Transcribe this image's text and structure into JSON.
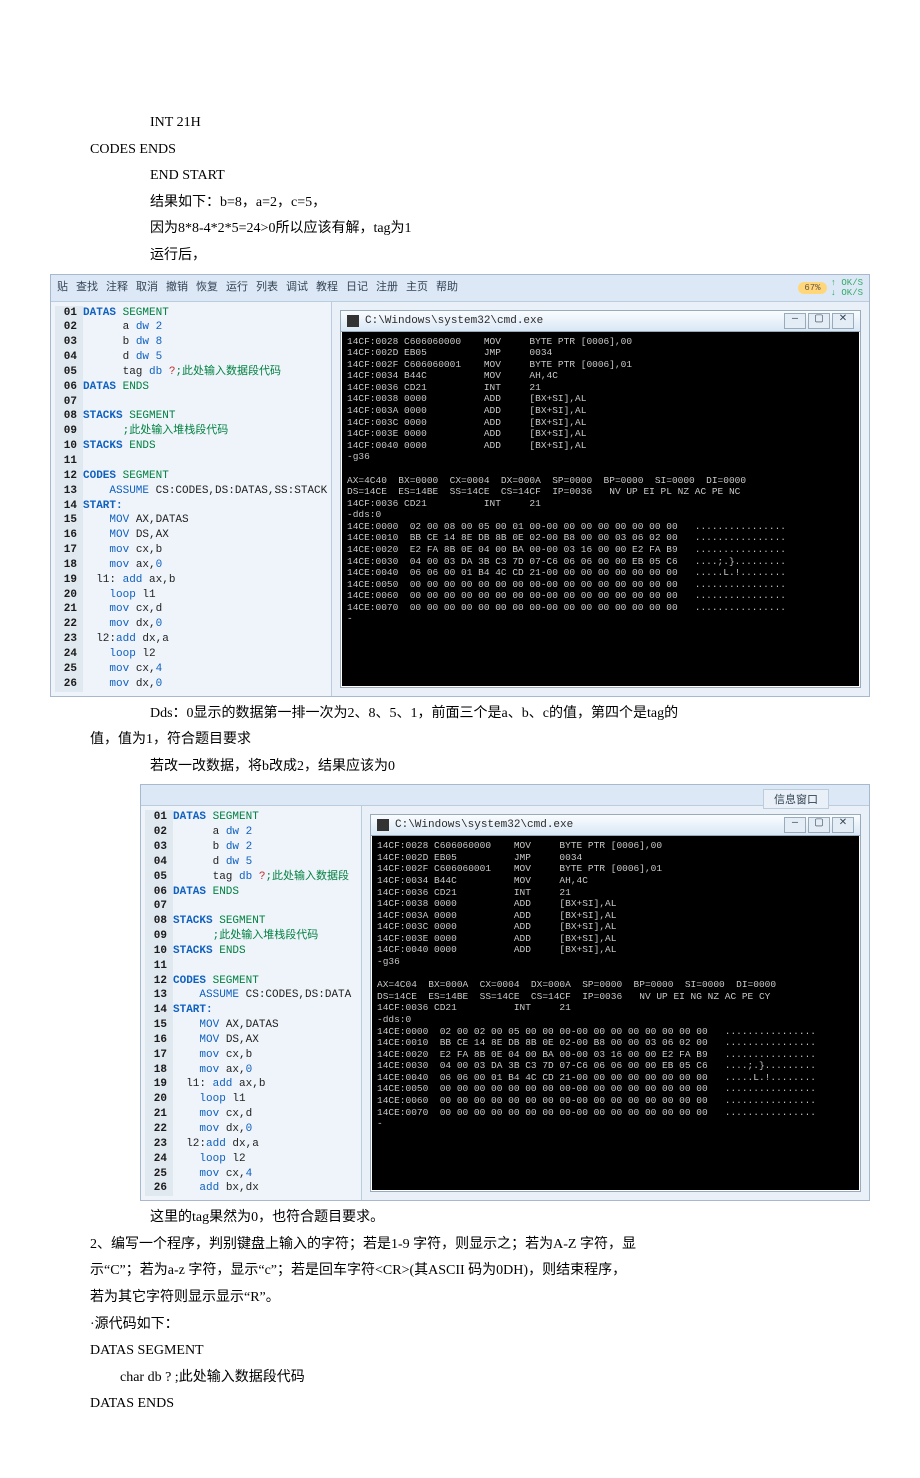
{
  "pre_lines": {
    "l1": "INT 21H",
    "l2": "CODES ENDS",
    "l3": "END START",
    "l4": "结果如下：b=8，a=2，c=5，",
    "l5": "因为8*8-4*2*5=24>0所以应该有解，tag为1",
    "l6": "运行后，"
  },
  "toolbar1": {
    "items": [
      "贴",
      "查找",
      "注释",
      "取消",
      "撤销",
      "恢复",
      "运行",
      "列表",
      "调试",
      "教程",
      "日记",
      "注册",
      "主页",
      "帮助"
    ],
    "pct": "67%",
    "net1": "OK/S",
    "net2": "OK/S"
  },
  "code1": [
    {
      "n": "01",
      "s": [
        [
          "kw",
          "DATAS "
        ],
        [
          "dir",
          "SEGMENT"
        ]
      ]
    },
    {
      "n": "02",
      "s": [
        [
          "ident",
          "      a "
        ],
        [
          "kw2",
          "dw "
        ],
        [
          "num",
          "2"
        ]
      ]
    },
    {
      "n": "03",
      "s": [
        [
          "ident",
          "      b "
        ],
        [
          "kw2",
          "dw "
        ],
        [
          "num",
          "8"
        ]
      ]
    },
    {
      "n": "04",
      "s": [
        [
          "ident",
          "      d "
        ],
        [
          "kw2",
          "dw "
        ],
        [
          "num",
          "5"
        ]
      ]
    },
    {
      "n": "05",
      "s": [
        [
          "ident",
          "      tag "
        ],
        [
          "kw2",
          "db "
        ],
        [
          "cmt",
          "?"
        ],
        [
          "dir",
          ";此处输入数据段代码"
        ]
      ]
    },
    {
      "n": "06",
      "s": [
        [
          "kw",
          "DATAS "
        ],
        [
          "dir",
          "ENDS"
        ]
      ]
    },
    {
      "n": "07",
      "s": [
        [
          "ident",
          ""
        ]
      ]
    },
    {
      "n": "08",
      "s": [
        [
          "kw",
          "STACKS "
        ],
        [
          "dir",
          "SEGMENT"
        ]
      ]
    },
    {
      "n": "09",
      "s": [
        [
          "dir",
          "      ;此处输入堆栈段代码"
        ]
      ]
    },
    {
      "n": "10",
      "s": [
        [
          "kw",
          "STACKS "
        ],
        [
          "dir",
          "ENDS"
        ]
      ]
    },
    {
      "n": "11",
      "s": [
        [
          "ident",
          ""
        ]
      ]
    },
    {
      "n": "12",
      "s": [
        [
          "kw",
          "CODES "
        ],
        [
          "dir",
          "SEGMENT"
        ]
      ]
    },
    {
      "n": "13",
      "s": [
        [
          "kw2",
          "    ASSUME "
        ],
        [
          "ident",
          "CS:CODES,DS:DATAS,SS:STACK"
        ]
      ]
    },
    {
      "n": "14",
      "s": [
        [
          "kw",
          "START:"
        ]
      ]
    },
    {
      "n": "15",
      "s": [
        [
          "kw2",
          "    MOV "
        ],
        [
          "ident",
          "AX,DATAS"
        ]
      ]
    },
    {
      "n": "16",
      "s": [
        [
          "kw2",
          "    MOV "
        ],
        [
          "ident",
          "DS,AX"
        ]
      ]
    },
    {
      "n": "17",
      "s": [
        [
          "kw2",
          "    mov "
        ],
        [
          "ident",
          "cx,b"
        ]
      ]
    },
    {
      "n": "18",
      "s": [
        [
          "kw2",
          "    mov "
        ],
        [
          "ident",
          "ax,"
        ],
        [
          "num",
          "0"
        ]
      ]
    },
    {
      "n": "19",
      "s": [
        [
          "ident",
          "  l1: "
        ],
        [
          "kw2",
          "add "
        ],
        [
          "ident",
          "ax,b"
        ]
      ]
    },
    {
      "n": "20",
      "s": [
        [
          "kw2",
          "    loop "
        ],
        [
          "ident",
          "l1"
        ]
      ]
    },
    {
      "n": "21",
      "s": [
        [
          "kw2",
          "    mov "
        ],
        [
          "ident",
          "cx,d"
        ]
      ]
    },
    {
      "n": "22",
      "s": [
        [
          "kw2",
          "    mov "
        ],
        [
          "ident",
          "dx,"
        ],
        [
          "num",
          "0"
        ]
      ]
    },
    {
      "n": "23",
      "s": [
        [
          "ident",
          "  l2:"
        ],
        [
          "kw2",
          "add "
        ],
        [
          "ident",
          "dx,a"
        ]
      ]
    },
    {
      "n": "24",
      "s": [
        [
          "kw2",
          "    loop "
        ],
        [
          "ident",
          "l2"
        ]
      ]
    },
    {
      "n": "25",
      "s": [
        [
          "kw2",
          "    mov "
        ],
        [
          "ident",
          "cx,"
        ],
        [
          "num",
          "4"
        ]
      ]
    },
    {
      "n": "26",
      "s": [
        [
          "kw2",
          "    mov "
        ],
        [
          "ident",
          "dx,"
        ],
        [
          "num",
          "0"
        ]
      ]
    }
  ],
  "cmd_title": "C:\\Windows\\system32\\cmd.exe",
  "cmd1_text": "14CF:0028 C606060000    MOV     BYTE PTR [0006],00\n14CF:002D EB05          JMP     0034\n14CF:002F C606060001    MOV     BYTE PTR [0006],01\n14CF:0034 B44C          MOV     AH,4C\n14CF:0036 CD21          INT     21\n14CF:0038 0000          ADD     [BX+SI],AL\n14CF:003A 0000          ADD     [BX+SI],AL\n14CF:003C 0000          ADD     [BX+SI],AL\n14CF:003E 0000          ADD     [BX+SI],AL\n14CF:0040 0000          ADD     [BX+SI],AL\n-g36\n\nAX=4C40  BX=0000  CX=0004  DX=000A  SP=0000  BP=0000  SI=0000  DI=0000\nDS=14CE  ES=14BE  SS=14CE  CS=14CF  IP=0036   NV UP EI PL NZ AC PE NC\n14CF:0036 CD21          INT     21\n-dds:0\n14CE:0000  02 00 08 00 05 00 01 00-00 00 00 00 00 00 00 00   ................\n14CE:0010  BB CE 14 8E DB 8B 0E 02-00 B8 00 00 03 06 02 00   ................\n14CE:0020  E2 FA 8B 0E 04 00 BA 00-00 03 16 00 00 E2 FA B9   ................\n14CE:0030  04 00 03 DA 3B C3 7D 07-C6 06 06 00 00 EB 05 C6   ....;.}.........\n14CE:0040  06 06 00 01 B4 4C CD 21-00 00 00 00 00 00 00 00   .....L.!........\n14CE:0050  00 00 00 00 00 00 00 00-00 00 00 00 00 00 00 00   ................\n14CE:0060  00 00 00 00 00 00 00 00-00 00 00 00 00 00 00 00   ................\n14CE:0070  00 00 00 00 00 00 00 00-00 00 00 00 00 00 00 00   ................\n-",
  "mid_lines": {
    "l1": "Dds：0显示的数据第一排一次为2、8、5、1，前面三个是a、b、c的值，第四个是tag的",
    "l2": "值，值为1，符合题目要求",
    "l3": "若改一改数据，将b改成2，结果应该为0"
  },
  "info_label": "信息窗口",
  "code2": [
    {
      "n": "01",
      "s": [
        [
          "kw",
          "DATAS "
        ],
        [
          "dir",
          "SEGMENT"
        ]
      ]
    },
    {
      "n": "02",
      "s": [
        [
          "ident",
          "      a "
        ],
        [
          "kw2",
          "dw "
        ],
        [
          "num",
          "2"
        ]
      ]
    },
    {
      "n": "03",
      "s": [
        [
          "ident",
          "      b "
        ],
        [
          "kw2",
          "dw "
        ],
        [
          "num",
          "2"
        ]
      ]
    },
    {
      "n": "04",
      "s": [
        [
          "ident",
          "      d "
        ],
        [
          "kw2",
          "dw "
        ],
        [
          "num",
          "5"
        ]
      ]
    },
    {
      "n": "05",
      "s": [
        [
          "ident",
          "      tag "
        ],
        [
          "kw2",
          "db "
        ],
        [
          "cmt",
          "?"
        ],
        [
          "dir",
          ";此处输入数据段"
        ]
      ]
    },
    {
      "n": "06",
      "s": [
        [
          "kw",
          "DATAS "
        ],
        [
          "dir",
          "ENDS"
        ]
      ]
    },
    {
      "n": "07",
      "s": [
        [
          "ident",
          ""
        ]
      ]
    },
    {
      "n": "08",
      "s": [
        [
          "kw",
          "STACKS "
        ],
        [
          "dir",
          "SEGMENT"
        ]
      ]
    },
    {
      "n": "09",
      "s": [
        [
          "dir",
          "      ;此处输入堆栈段代码"
        ]
      ]
    },
    {
      "n": "10",
      "s": [
        [
          "kw",
          "STACKS "
        ],
        [
          "dir",
          "ENDS"
        ]
      ]
    },
    {
      "n": "11",
      "s": [
        [
          "ident",
          ""
        ]
      ]
    },
    {
      "n": "12",
      "s": [
        [
          "kw",
          "CODES "
        ],
        [
          "dir",
          "SEGMENT"
        ]
      ]
    },
    {
      "n": "13",
      "s": [
        [
          "kw2",
          "    ASSUME "
        ],
        [
          "ident",
          "CS:CODES,DS:DATA"
        ]
      ]
    },
    {
      "n": "14",
      "s": [
        [
          "kw",
          "START:"
        ]
      ]
    },
    {
      "n": "15",
      "s": [
        [
          "kw2",
          "    MOV "
        ],
        [
          "ident",
          "AX,DATAS"
        ]
      ]
    },
    {
      "n": "16",
      "s": [
        [
          "kw2",
          "    MOV "
        ],
        [
          "ident",
          "DS,AX"
        ]
      ]
    },
    {
      "n": "17",
      "s": [
        [
          "kw2",
          "    mov "
        ],
        [
          "ident",
          "cx,b"
        ]
      ]
    },
    {
      "n": "18",
      "s": [
        [
          "kw2",
          "    mov "
        ],
        [
          "ident",
          "ax,"
        ],
        [
          "num",
          "0"
        ]
      ]
    },
    {
      "n": "19",
      "s": [
        [
          "ident",
          "  l1: "
        ],
        [
          "kw2",
          "add "
        ],
        [
          "ident",
          "ax,b"
        ]
      ]
    },
    {
      "n": "20",
      "s": [
        [
          "kw2",
          "    loop "
        ],
        [
          "ident",
          "l1"
        ]
      ]
    },
    {
      "n": "21",
      "s": [
        [
          "kw2",
          "    mov "
        ],
        [
          "ident",
          "cx,d"
        ]
      ]
    },
    {
      "n": "22",
      "s": [
        [
          "kw2",
          "    mov "
        ],
        [
          "ident",
          "dx,"
        ],
        [
          "num",
          "0"
        ]
      ]
    },
    {
      "n": "23",
      "s": [
        [
          "ident",
          "  l2:"
        ],
        [
          "kw2",
          "add "
        ],
        [
          "ident",
          "dx,a"
        ]
      ]
    },
    {
      "n": "24",
      "s": [
        [
          "kw2",
          "    loop "
        ],
        [
          "ident",
          "l2"
        ]
      ]
    },
    {
      "n": "25",
      "s": [
        [
          "kw2",
          "    mov "
        ],
        [
          "ident",
          "cx,"
        ],
        [
          "num",
          "4"
        ]
      ]
    },
    {
      "n": "26",
      "s": [
        [
          "kw2",
          "    add "
        ],
        [
          "ident",
          "bx,dx"
        ]
      ]
    }
  ],
  "cmd2_text": "14CF:0028 C606060000    MOV     BYTE PTR [0006],00\n14CF:002D EB05          JMP     0034\n14CF:002F C606060001    MOV     BYTE PTR [0006],01\n14CF:0034 B44C          MOV     AH,4C\n14CF:0036 CD21          INT     21\n14CF:0038 0000          ADD     [BX+SI],AL\n14CF:003A 0000          ADD     [BX+SI],AL\n14CF:003C 0000          ADD     [BX+SI],AL\n14CF:003E 0000          ADD     [BX+SI],AL\n14CF:0040 0000          ADD     [BX+SI],AL\n-g36\n\nAX=4C04  BX=000A  CX=0004  DX=000A  SP=0000  BP=0000  SI=0000  DI=0000\nDS=14CE  ES=14BE  SS=14CE  CS=14CF  IP=0036   NV UP EI NG NZ AC PE CY\n14CF:0036 CD21          INT     21\n-dds:0\n14CE:0000  02 00 02 00 05 00 00 00-00 00 00 00 00 00 00 00   ................\n14CE:0010  BB CE 14 8E DB 8B 0E 02-00 B8 00 00 03 06 02 00   ................\n14CE:0020  E2 FA 8B 0E 04 00 BA 00-00 03 16 00 00 E2 FA B9   ................\n14CE:0030  04 00 03 DA 3B C3 7D 07-C6 06 06 00 00 EB 05 C6   ....;.}.........\n14CE:0040  06 06 00 01 B4 4C CD 21-00 00 00 00 00 00 00 00   .....L.!........\n14CE:0050  00 00 00 00 00 00 00 00-00 00 00 00 00 00 00 00   ................\n14CE:0060  00 00 00 00 00 00 00 00-00 00 00 00 00 00 00 00   ................\n14CE:0070  00 00 00 00 00 00 00 00-00 00 00 00 00 00 00 00   ................\n-",
  "post_lines": {
    "l1": "这里的tag果然为0，也符合题目要求。",
    "l2": "2、编写一个程序，判别键盘上输入的字符；若是1-9 字符，则显示之；若为A-Z 字符，显",
    "l3": "示“C”；若为a-z 字符，显示“c”；若是回车字符<CR>(其ASCII 码为0DH)，则结束程序，",
    "l4": "若为其它字符则显示显示“R”。",
    "l5": "·源代码如下：",
    "l6": "DATAS SEGMENT",
    "l7": "char db ? ;此处输入数据段代码",
    "l8": "DATAS ENDS"
  }
}
